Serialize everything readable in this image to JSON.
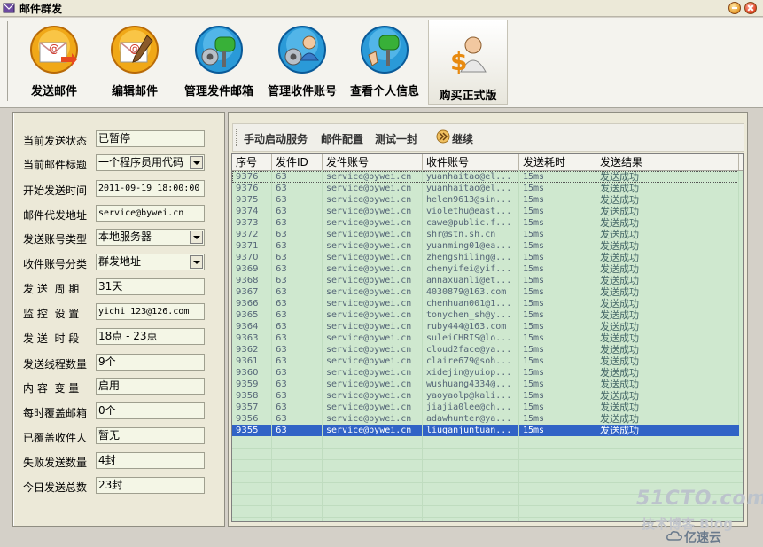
{
  "window": {
    "title": "邮件群发"
  },
  "toolbar": {
    "buttons": [
      {
        "label": "发送邮件",
        "icon": "mail-send-icon"
      },
      {
        "label": "编辑邮件",
        "icon": "mail-edit-icon"
      },
      {
        "label": "管理发件邮箱",
        "icon": "mailbox-gear-icon"
      },
      {
        "label": "管理收件账号",
        "icon": "accounts-gear-icon"
      },
      {
        "label": "查看个人信息",
        "icon": "mailbox-hand-icon"
      },
      {
        "label": "购买正式版",
        "icon": "dollar-person-icon"
      }
    ]
  },
  "status_panel": {
    "fields": [
      {
        "label": "当前发送状态",
        "value": "已暂停"
      },
      {
        "label": "当前邮件标题",
        "value": "一个程序员用代码"
      },
      {
        "label": "开始发送时间",
        "value": "2011-09-19 18:00:00"
      },
      {
        "label": "邮件代发地址",
        "value": "service@bywei.cn"
      },
      {
        "label": "发送账号类型",
        "value": "本地服务器"
      },
      {
        "label": "收件账号分类",
        "value": "群发地址"
      },
      {
        "label": "发 送  周 期",
        "value": "31天"
      },
      {
        "label": "监 控  设 置",
        "value": "yichi_123@126.com"
      },
      {
        "label": "发 送  时 段",
        "value": "18点 - 23点"
      },
      {
        "label": "发送线程数量",
        "value": "9个"
      },
      {
        "label": "内 容  变 量",
        "value": "启用"
      },
      {
        "label": "每时覆盖邮箱",
        "value": "0个"
      },
      {
        "label": "已覆盖收件人",
        "value": "暂无"
      },
      {
        "label": "失败发送数量",
        "value": "4封"
      },
      {
        "label": "今日发送总数",
        "value": "23封"
      }
    ]
  },
  "right_toolbar": {
    "start_service": "手动启动服务",
    "mail_config": "邮件配置",
    "test_one": "测试一封",
    "continue": "继续"
  },
  "table": {
    "columns": [
      "序号",
      "发件ID",
      "发件账号",
      "收件账号",
      "发送耗时",
      "发送结果"
    ],
    "rows": [
      [
        "9376",
        "63",
        "service@bywei.cn",
        "yuanhaitao@el...",
        "15ms",
        "发送成功"
      ],
      [
        "9376",
        "63",
        "service@bywei.cn",
        "yuanhaitao@el...",
        "15ms",
        "发送成功"
      ],
      [
        "9375",
        "63",
        "service@bywei.cn",
        "helen9613@sin...",
        "15ms",
        "发送成功"
      ],
      [
        "9374",
        "63",
        "service@bywei.cn",
        "violethu@east...",
        "15ms",
        "发送成功"
      ],
      [
        "9373",
        "63",
        "service@bywei.cn",
        "cawe@public.f...",
        "15ms",
        "发送成功"
      ],
      [
        "9372",
        "63",
        "service@bywei.cn",
        "shr@stn.sh.cn",
        "15ms",
        "发送成功"
      ],
      [
        "9371",
        "63",
        "service@bywei.cn",
        "yuanming01@ea...",
        "15ms",
        "发送成功"
      ],
      [
        "9370",
        "63",
        "service@bywei.cn",
        "zhengshiling@...",
        "15ms",
        "发送成功"
      ],
      [
        "9369",
        "63",
        "service@bywei.cn",
        "chenyifei@yif...",
        "15ms",
        "发送成功"
      ],
      [
        "9368",
        "63",
        "service@bywei.cn",
        "annaxuanli@et...",
        "15ms",
        "发送成功"
      ],
      [
        "9367",
        "63",
        "service@bywei.cn",
        "4030879@163.com",
        "15ms",
        "发送成功"
      ],
      [
        "9366",
        "63",
        "service@bywei.cn",
        "chenhuan001@1...",
        "15ms",
        "发送成功"
      ],
      [
        "9365",
        "63",
        "service@bywei.cn",
        "tonychen_sh@y...",
        "15ms",
        "发送成功"
      ],
      [
        "9364",
        "63",
        "service@bywei.cn",
        "ruby444@163.com",
        "15ms",
        "发送成功"
      ],
      [
        "9363",
        "63",
        "service@bywei.cn",
        "suleiCHRIS@lo...",
        "15ms",
        "发送成功"
      ],
      [
        "9362",
        "63",
        "service@bywei.cn",
        "cloud2face@ya...",
        "15ms",
        "发送成功"
      ],
      [
        "9361",
        "63",
        "service@bywei.cn",
        "claire679@soh...",
        "15ms",
        "发送成功"
      ],
      [
        "9360",
        "63",
        "service@bywei.cn",
        "xidejin@yuiop...",
        "15ms",
        "发送成功"
      ],
      [
        "9359",
        "63",
        "service@bywei.cn",
        "wushuang4334@...",
        "15ms",
        "发送成功"
      ],
      [
        "9358",
        "63",
        "service@bywei.cn",
        "yaoyaolp@kali...",
        "15ms",
        "发送成功"
      ],
      [
        "9357",
        "63",
        "service@bywei.cn",
        "jiajia0lee@ch...",
        "15ms",
        "发送成功"
      ],
      [
        "9356",
        "63",
        "service@bywei.cn",
        "adawhunter@ya...",
        "15ms",
        "发送成功"
      ],
      [
        "9355",
        "63",
        "service@bywei.cn",
        "liuganjuntuan...",
        "15ms",
        "发送成功"
      ]
    ],
    "selected_row": 22
  },
  "watermark": {
    "text": "51CTO.com",
    "sub": "技术博客  Blog",
    "brand": "亿速云"
  },
  "colors": {
    "grid_bg": "#cfe8cf",
    "selection": "#3163c6",
    "toolbar_bg": "#f4f3ee"
  }
}
